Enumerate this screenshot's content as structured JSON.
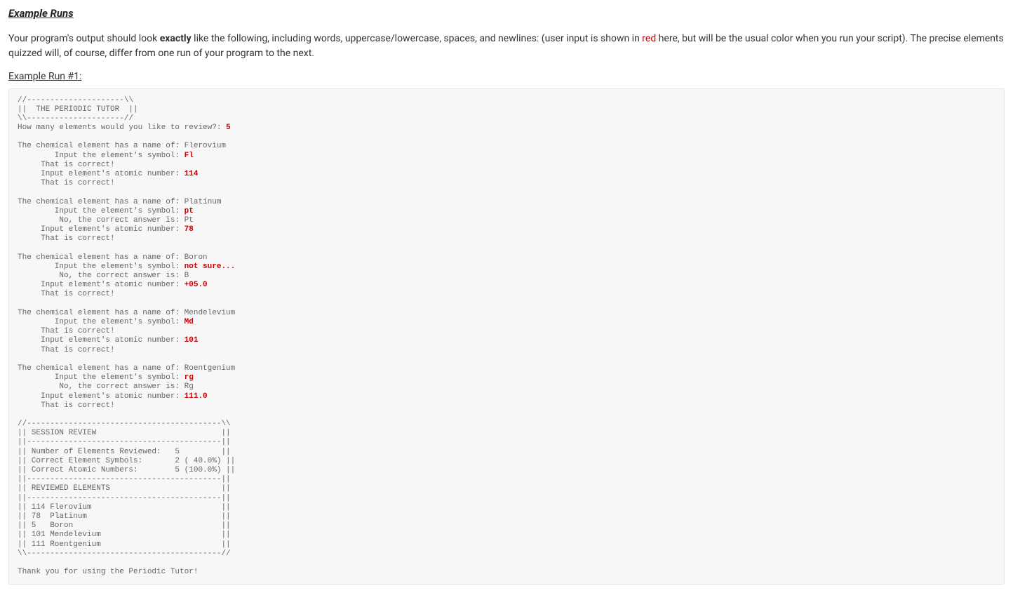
{
  "section_title": "Example Runs",
  "intro_part1": "Your program's output should look ",
  "intro_bold": "exactly",
  "intro_part2": " like the following, including words, uppercase/lowercase, spaces, and newlines: (user input is shown in ",
  "intro_red": "red",
  "intro_part3": " here, but will be the usual color when you run your script).  The precise elements quizzed will, of course, differ from one run of your program to the next.",
  "example_label": "Example Run #1:",
  "run": {
    "header_top": "//---------------------\\\\",
    "header_mid": "||  THE PERIODIC TUTOR  ||",
    "header_bot": "\\\\---------------------//",
    "prompt_count": "How many elements would you like to review?: ",
    "input_count": "5",
    "blank": "",
    "elems": [
      {
        "name_line": "The chemical element has a name of: Flerovium",
        "sym_prompt": "        Input the element's symbol: ",
        "sym_input": "Fl",
        "sym_result": "     That is correct!",
        "num_prompt": "     Input element's atomic number: ",
        "num_input": "114",
        "num_result": "     That is correct!"
      },
      {
        "name_line": "The chemical element has a name of: Platinum",
        "sym_prompt": "        Input the element's symbol: ",
        "sym_input": "pt",
        "sym_result": "         No, the correct answer is: Pt",
        "num_prompt": "     Input element's atomic number: ",
        "num_input": "78",
        "num_result": "     That is correct!"
      },
      {
        "name_line": "The chemical element has a name of: Boron",
        "sym_prompt": "        Input the element's symbol: ",
        "sym_input": "not sure...",
        "sym_result": "         No, the correct answer is: B",
        "num_prompt": "     Input element's atomic number: ",
        "num_input": "+05.0",
        "num_result": "     That is correct!"
      },
      {
        "name_line": "The chemical element has a name of: Mendelevium",
        "sym_prompt": "        Input the element's symbol: ",
        "sym_input": "Md",
        "sym_result": "     That is correct!",
        "num_prompt": "     Input element's atomic number: ",
        "num_input": "101",
        "num_result": "     That is correct!"
      },
      {
        "name_line": "The chemical element has a name of: Roentgenium",
        "sym_prompt": "        Input the element's symbol: ",
        "sym_input": "rg",
        "sym_result": "         No, the correct answer is: Rg",
        "num_prompt": "     Input element's atomic number: ",
        "num_input": "111.0",
        "num_result": "     That is correct!"
      }
    ],
    "review": [
      "//------------------------------------------\\\\",
      "|| SESSION REVIEW                           ||",
      "||------------------------------------------||",
      "|| Number of Elements Reviewed:   5         ||",
      "|| Correct Element Symbols:       2 ( 40.0%) ||",
      "|| Correct Atomic Numbers:        5 (100.0%) ||",
      "||------------------------------------------||",
      "|| REVIEWED ELEMENTS                        ||",
      "||------------------------------------------||",
      "|| 114 Flerovium                            ||",
      "|| 78  Platinum                             ||",
      "|| 5   Boron                                ||",
      "|| 101 Mendelevium                          ||",
      "|| 111 Roentgenium                          ||",
      "\\\\------------------------------------------//"
    ],
    "thanks": "Thank you for using the Periodic Tutor!"
  }
}
